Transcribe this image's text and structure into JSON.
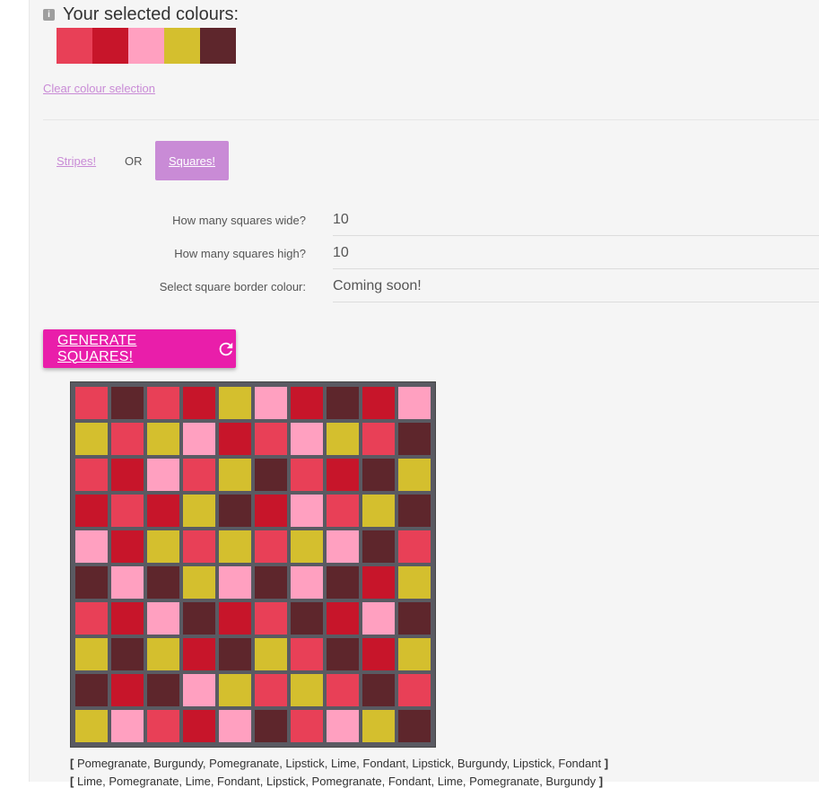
{
  "palette": {
    "Pomegranate": "#e84057",
    "Lipstick": "#c7152a",
    "Fondant": "#ffa0c0",
    "Lime": "#d4bf2e",
    "Burgundy": "#5e262c"
  },
  "selected": {
    "info_icon": "i",
    "title": "Your selected colours:",
    "swatches": [
      "Pomegranate",
      "Lipstick",
      "Fondant",
      "Lime",
      "Burgundy"
    ],
    "clear_link": "Clear colour selection"
  },
  "mode": {
    "stripes_label": "Stripes!",
    "or_label": "OR",
    "squares_label": "Squares!"
  },
  "form": {
    "wide_label": "How many squares wide?",
    "wide_value": "10",
    "high_label": "How many squares high?",
    "high_value": "10",
    "border_label": "Select square border colour:",
    "border_value": "Coming soon!"
  },
  "generate_label": "GENERATE SQUARES!",
  "grid_rows": [
    [
      "Pomegranate",
      "Burgundy",
      "Pomegranate",
      "Lipstick",
      "Lime",
      "Fondant",
      "Lipstick",
      "Burgundy",
      "Lipstick",
      "Fondant"
    ],
    [
      "Lime",
      "Pomegranate",
      "Lime",
      "Fondant",
      "Lipstick",
      "Pomegranate",
      "Fondant",
      "Lime",
      "Pomegranate",
      "Burgundy"
    ],
    [
      "Pomegranate",
      "Lipstick",
      "Fondant",
      "Pomegranate",
      "Lime",
      "Burgundy",
      "Pomegranate",
      "Lipstick",
      "Burgundy",
      "Lime"
    ],
    [
      "Lipstick",
      "Pomegranate",
      "Lipstick",
      "Lime",
      "Burgundy",
      "Lipstick",
      "Fondant",
      "Pomegranate",
      "Lime",
      "Burgundy"
    ],
    [
      "Fondant",
      "Lipstick",
      "Lime",
      "Pomegranate",
      "Lime",
      "Pomegranate",
      "Lime",
      "Fondant",
      "Burgundy",
      "Pomegranate"
    ],
    [
      "Burgundy",
      "Fondant",
      "Burgundy",
      "Lime",
      "Fondant",
      "Burgundy",
      "Fondant",
      "Burgundy",
      "Lipstick",
      "Lime"
    ],
    [
      "Pomegranate",
      "Lipstick",
      "Fondant",
      "Burgundy",
      "Lipstick",
      "Pomegranate",
      "Burgundy",
      "Lipstick",
      "Fondant",
      "Burgundy"
    ],
    [
      "Lime",
      "Burgundy",
      "Lime",
      "Lipstick",
      "Burgundy",
      "Lime",
      "Pomegranate",
      "Burgundy",
      "Lipstick",
      "Lime"
    ],
    [
      "Burgundy",
      "Lipstick",
      "Burgundy",
      "Fondant",
      "Lime",
      "Pomegranate",
      "Lime",
      "Pomegranate",
      "Burgundy",
      "Pomegranate"
    ],
    [
      "Lime",
      "Fondant",
      "Pomegranate",
      "Lipstick",
      "Fondant",
      "Burgundy",
      "Pomegranate",
      "Fondant",
      "Lime",
      "Burgundy"
    ]
  ],
  "row_list_1": "Pomegranate, Burgundy, Pomegranate, Lipstick, Lime, Fondant, Lipstick, Burgundy, Lipstick, Fondant",
  "row_list_2": "Lime, Pomegranate, Lime, Fondant, Lipstick, Pomegranate, Fondant, Lime, Pomegranate, Burgundy",
  "bracket_open": "[",
  "bracket_close": "]"
}
